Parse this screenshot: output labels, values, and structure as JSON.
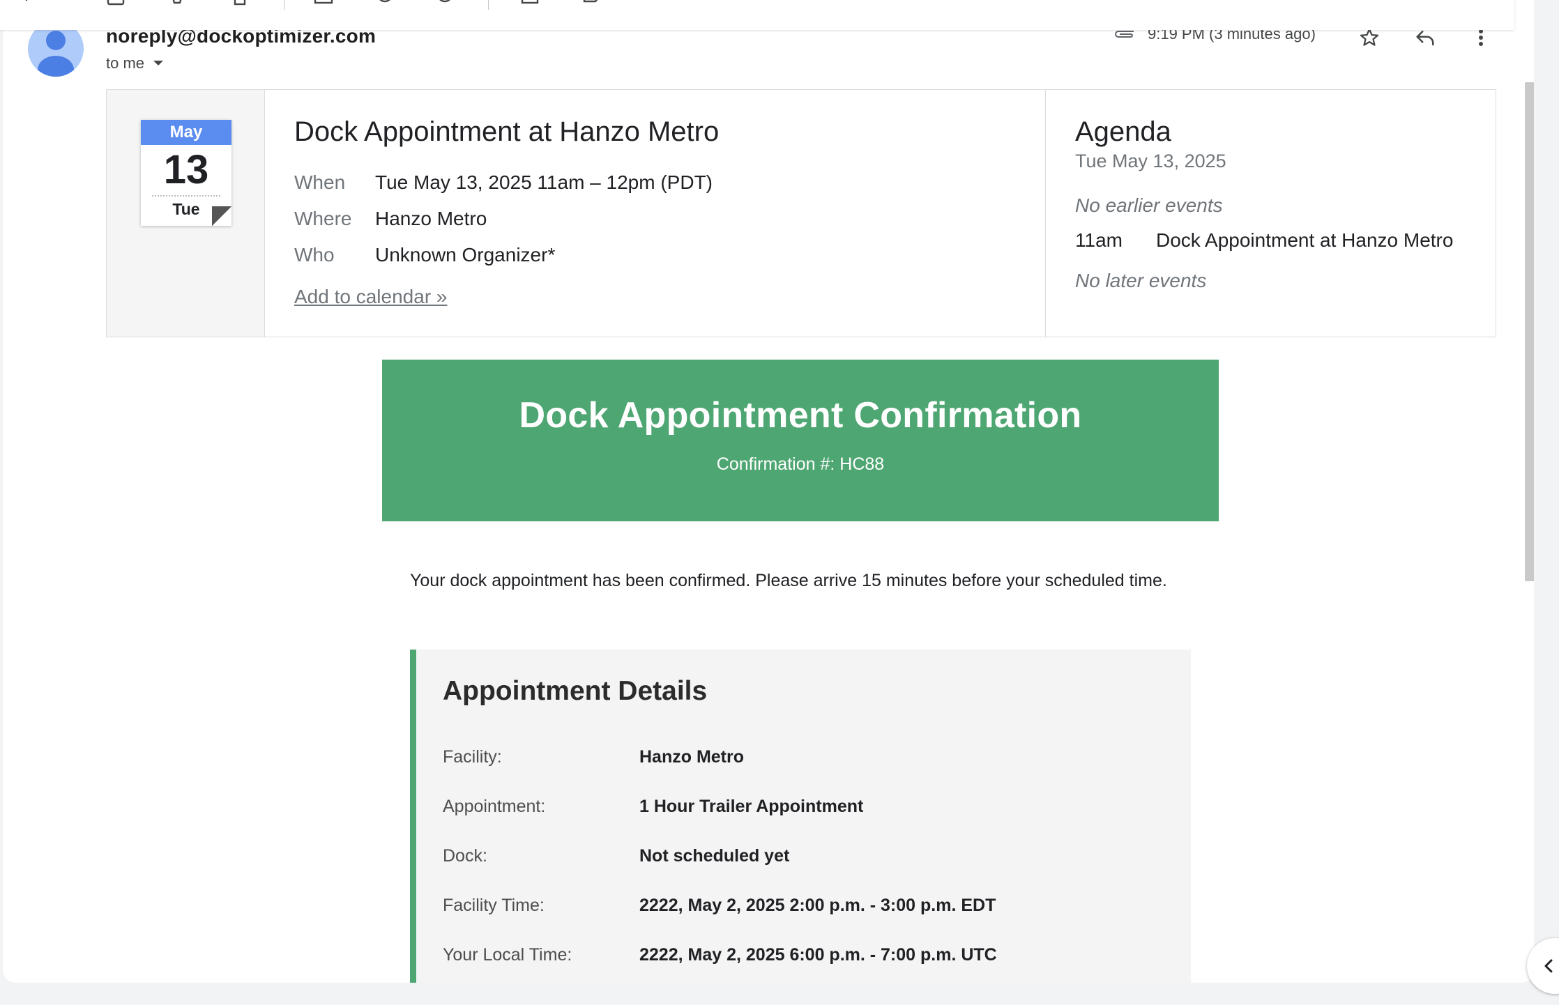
{
  "email": {
    "sender": "noreply@dockoptimizer.com",
    "recipient": "to me",
    "timestamp": "9:19 PM (3 minutes ago)"
  },
  "invite": {
    "calendar": {
      "month": "May",
      "day": "13",
      "weekday": "Tue"
    },
    "title": "Dock Appointment at Hanzo Metro",
    "rows": [
      {
        "label": "When",
        "value": "Tue May 13, 2025 11am – 12pm (PDT)"
      },
      {
        "label": "Where",
        "value": "Hanzo Metro"
      },
      {
        "label": "Who",
        "value": "Unknown Organizer*"
      }
    ],
    "add_link": "Add to calendar »"
  },
  "agenda": {
    "title": "Agenda",
    "date": "Tue May 13, 2025",
    "no_earlier": "No earlier events",
    "event_time": "11am",
    "event_title": "Dock Appointment at Hanzo Metro",
    "no_later": "No later events"
  },
  "banner": {
    "title": "Dock Appointment Confirmation",
    "subtitle": "Confirmation #: HC88",
    "color": "#4ea672"
  },
  "intro": "Your dock appointment has been confirmed. Please arrive 15 minutes before your scheduled time.",
  "details": {
    "title": "Appointment Details",
    "rows": [
      {
        "label": "Facility:",
        "value": "Hanzo Metro"
      },
      {
        "label": "Appointment:",
        "value": "1 Hour Trailer Appointment"
      },
      {
        "label": "Dock:",
        "value": "Not scheduled yet"
      },
      {
        "label": "Facility Time:",
        "value": "2222, May 2, 2025 2:00 p.m. - 3:00 p.m. EDT"
      },
      {
        "label": "Your Local Time:",
        "value": "2222, May 2, 2025 6:00 p.m. - 7:00 p.m. UTC"
      }
    ]
  },
  "icons": {
    "attachment": "paperclip-icon",
    "star": "star-icon",
    "reply": "reply-icon",
    "more": "more-vert-icon",
    "dropdown": "caret-down-icon",
    "side_panel": "chevron-left-icon"
  }
}
